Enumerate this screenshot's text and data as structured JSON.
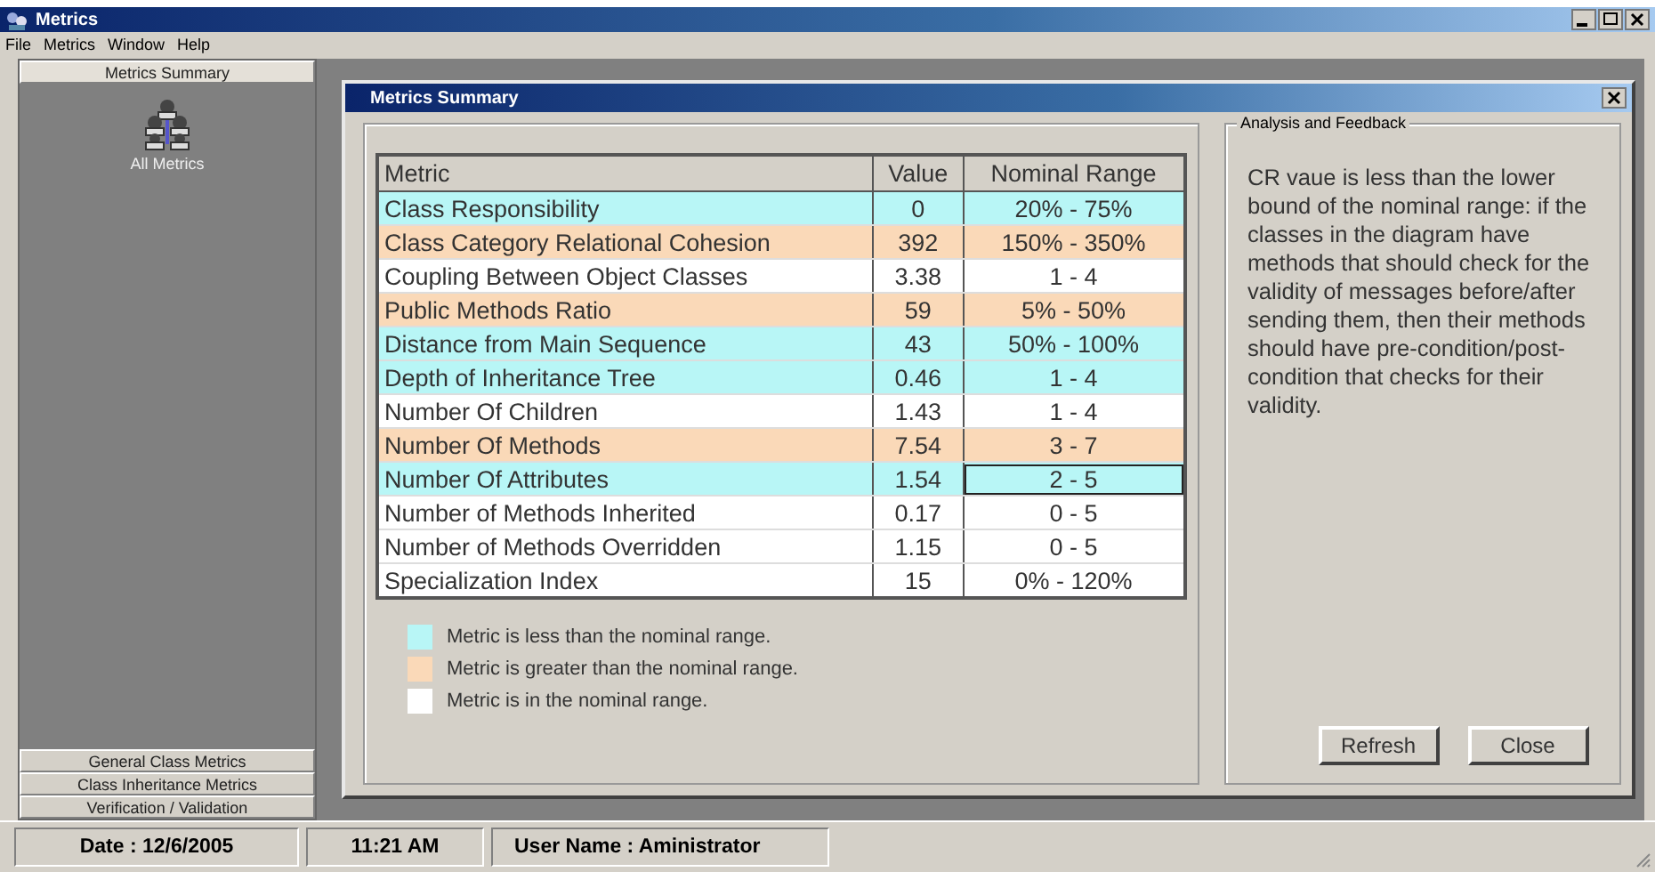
{
  "window": {
    "title": "Metrics"
  },
  "menu": [
    "File",
    "Metrics",
    "Window",
    "Help"
  ],
  "sidebar": {
    "sections": [
      {
        "label": "Metrics Summary",
        "selected": true
      }
    ],
    "items": [
      {
        "label": "All Metrics"
      }
    ],
    "bottom_sections": [
      {
        "label": "General Class Metrics",
        "selected": false
      },
      {
        "label": "Class Inheritance Metrics",
        "selected": false
      },
      {
        "label": "Verification / Validation",
        "selected": false
      }
    ]
  },
  "dialog": {
    "title": "Metrics Summary",
    "table": {
      "columns": [
        "Metric",
        "Value",
        "Nominal Range"
      ],
      "rows": [
        {
          "metric": "Class Responsibility",
          "value": "0",
          "range": "20% - 75%",
          "color": "#b8f6f6",
          "selected": false
        },
        {
          "metric": "Class Category Relational Cohesion",
          "value": "392",
          "range": "150% - 350%",
          "color": "#fad9b8",
          "selected": false
        },
        {
          "metric": "Coupling Between Object Classes",
          "value": "3.38",
          "range": "1 - 4",
          "color": "#ffffff",
          "selected": false
        },
        {
          "metric": "Public Methods Ratio",
          "value": "59",
          "range": "5% - 50%",
          "color": "#fad9b8",
          "selected": false
        },
        {
          "metric": "Distance from Main Sequence",
          "value": "43",
          "range": "50% - 100%",
          "color": "#b8f6f6",
          "selected": false
        },
        {
          "metric": "Depth of Inheritance Tree",
          "value": "0.46",
          "range": "1 - 4",
          "color": "#b8f6f6",
          "selected": false
        },
        {
          "metric": "Number Of Children",
          "value": "1.43",
          "range": "1 - 4",
          "color": "#ffffff",
          "selected": false
        },
        {
          "metric": "Number Of Methods",
          "value": "7.54",
          "range": "3 - 7",
          "color": "#fad9b8",
          "selected": false
        },
        {
          "metric": "Number Of Attributes",
          "value": "1.54",
          "range": "2 - 5",
          "color": "#b8f6f6",
          "selected": true
        },
        {
          "metric": "Number of Methods Inherited",
          "value": "0.17",
          "range": "0 - 5",
          "color": "#ffffff",
          "selected": false
        },
        {
          "metric": "Number of Methods Overridden",
          "value": "1.15",
          "range": "0 - 5",
          "color": "#ffffff",
          "selected": false
        },
        {
          "metric": "Specialization Index",
          "value": "15",
          "range": "0% - 120%",
          "color": "#ffffff",
          "selected": false
        }
      ]
    },
    "legend": [
      {
        "color": "#b8f6f6",
        "label": "Metric is less than the nominal range."
      },
      {
        "color": "#fad9b8",
        "label": "Metric is greater than the nominal range."
      },
      {
        "color": "#ffffff",
        "label": "Metric is in the nominal range."
      }
    ],
    "analysis": {
      "title": "Analysis and Feedback",
      "text": "CR vaue is less than the lower bound of the nominal range: if the classes in the diagram have methods that should check for the validity of messages before/after sending them, then their methods should have pre-condition/post-condition that checks for their validity."
    },
    "buttons": [
      "Refresh",
      "Close"
    ]
  },
  "status_bar": [
    "Date : 12/6/2005",
    "11:21 AM",
    "User Name : Aministrator"
  ]
}
